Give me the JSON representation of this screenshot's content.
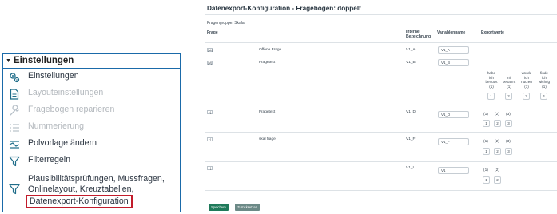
{
  "settings_panel": {
    "header": "Einstellungen",
    "items": [
      {
        "label": "Einstellungen",
        "icon": "gears-icon",
        "disabled": false
      },
      {
        "label": "Layouteinstellungen",
        "icon": "document-icon",
        "disabled": true
      },
      {
        "label": "Fragebogen reparieren",
        "icon": "wrench-icon",
        "disabled": true
      },
      {
        "label": "Nummerierung",
        "icon": "numbered-list-icon",
        "disabled": true
      },
      {
        "label": "Polvorlage ändern",
        "icon": "pole-template-icon",
        "disabled": false
      },
      {
        "label": "Filterregeln",
        "icon": "filter-icon",
        "disabled": false
      },
      {
        "label_line1": "Plausibilitätsprüfungen, Mussfragen,",
        "label_line2": "Onlinelayout, Kreuztabellen,",
        "label_line3": "Datenexport-Konfiguration",
        "icon": "filter-icon",
        "disabled": false
      }
    ]
  },
  "form": {
    "title": "Datenexport-Konfiguration - Fragebogen: doppelt",
    "group_label": "Fragengruppe: Skala",
    "columns": {
      "frage": "Frage",
      "interne_line1": "Interne",
      "interne_line2": "Bezeichnung",
      "variablenname": "Variablenname",
      "exportwerte": "Exportwerte"
    },
    "rows": [
      {
        "type": "[ab]",
        "text": "Offene Frage",
        "internal": "V1_A",
        "variable": "V1_A"
      },
      {
        "type": "[M]",
        "text": "Fragetext",
        "internal": "V1_B",
        "variable": "V1_B"
      },
      {
        "type": "[·]",
        "text": "Fragetext",
        "internal": "V1_D",
        "variable": "V1_D"
      },
      {
        "type": "[·]",
        "text": "skal frage",
        "internal": "V1_F",
        "variable": "V1_F"
      },
      {
        "type": "[·]",
        "text": "",
        "internal": "V1_I",
        "variable": "V1_I"
      }
    ],
    "row2_export": {
      "labels": [
        {
          "l1": "habe",
          "l2": "ich",
          "l3": "benutzt",
          "l4": "(1)"
        },
        {
          "l1": "",
          "l2": "mir",
          "l3": "bekannt",
          "l4": "(1)"
        },
        {
          "l1": "würde",
          "l2": "ich",
          "l3": "nutzen",
          "l4": "(1)"
        },
        {
          "l1": "finde",
          "l2": "ich",
          "l3": "wichtig",
          "l4": "(1)"
        }
      ],
      "values": [
        "1",
        "2",
        "3",
        "4"
      ]
    },
    "row3_export": {
      "labels": [
        "(1)",
        "(2)",
        "(3)"
      ],
      "values": [
        "1",
        "2",
        "3"
      ]
    },
    "row4_export": {
      "labels": [
        "(1)",
        "(2)",
        "(3)"
      ],
      "values": [
        "1",
        "2",
        "3"
      ]
    },
    "row5_export": {
      "labels": [
        "(1)",
        "(2)"
      ],
      "values": [
        "1",
        "2"
      ]
    },
    "buttons": {
      "save": "Speichern",
      "back": "Zurücksetzen"
    }
  }
}
